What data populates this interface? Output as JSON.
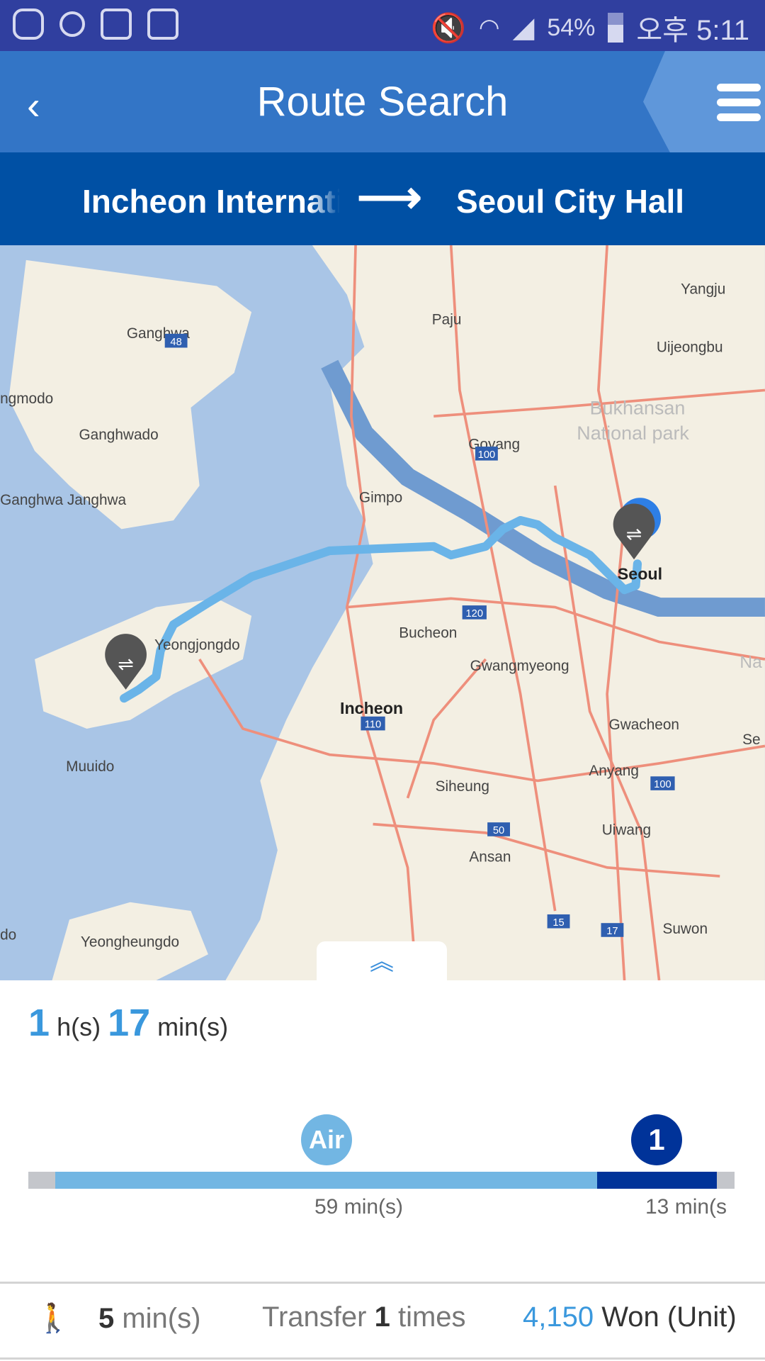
{
  "status_bar": {
    "battery": "54%",
    "time": "오후 5:11",
    "icons": [
      "uplus-icon",
      "face-icon",
      "image-icon",
      "clipboard-check-icon",
      "vibrate-mute-icon",
      "wifi-icon",
      "signal-icon",
      "battery-icon"
    ]
  },
  "header": {
    "title": "Route Search",
    "back_icon": "chevron-left-icon",
    "menu_icon": "hamburger-icon"
  },
  "route": {
    "from": "Incheon International Airport",
    "to": "Seoul City Hall",
    "arrow": "⟶"
  },
  "map": {
    "labels": [
      "Ganghwa",
      "Paju",
      "Yangju",
      "Uijeongbu",
      "ngmodo",
      "Ganghwado",
      "Bukhansan",
      "National park",
      "Goyang",
      "Ganghwa Janghwa",
      "Gimpo",
      "Seoul",
      "Bucheon",
      "Yeongjongdo",
      "Gwangmyeong",
      "Incheon",
      "Gwacheon",
      "Se",
      "Na",
      "Muuido",
      "Anyang",
      "Siheung",
      "Uiwang",
      "Ansan",
      "Suwon",
      "Yeongheungdo",
      "do"
    ],
    "shields": [
      "48",
      "100",
      "120",
      "110",
      "100",
      "50",
      "15",
      "17"
    ],
    "route_color": "#6ab4e8"
  },
  "pull_tab": {
    "icon": "double-chevron-up-icon",
    "glyph": "︽"
  },
  "summary": {
    "hours": "1",
    "hours_unit": "h(s)",
    "minutes": "17",
    "minutes_unit": "min(s)"
  },
  "timeline": {
    "segments": [
      {
        "kind": "walk",
        "minutes": null,
        "color": "#c4c6cb"
      },
      {
        "label": "Air",
        "minutes": 59,
        "text": "59 min(s)",
        "color": "#72b6e3"
      },
      {
        "label": "1",
        "minutes": 13,
        "text": "13 min(s",
        "color": "#003399"
      },
      {
        "kind": "walk",
        "minutes": null,
        "color": "#c4c6cb"
      }
    ]
  },
  "footer": {
    "walk_icon": "walk-icon",
    "walk_minutes": "5",
    "walk_unit": "min(s)",
    "transfer_prefix": "Transfer",
    "transfer_count": "1",
    "transfer_suffix": "times",
    "fare": "4,150",
    "fare_unit": "Won (Unit)"
  }
}
